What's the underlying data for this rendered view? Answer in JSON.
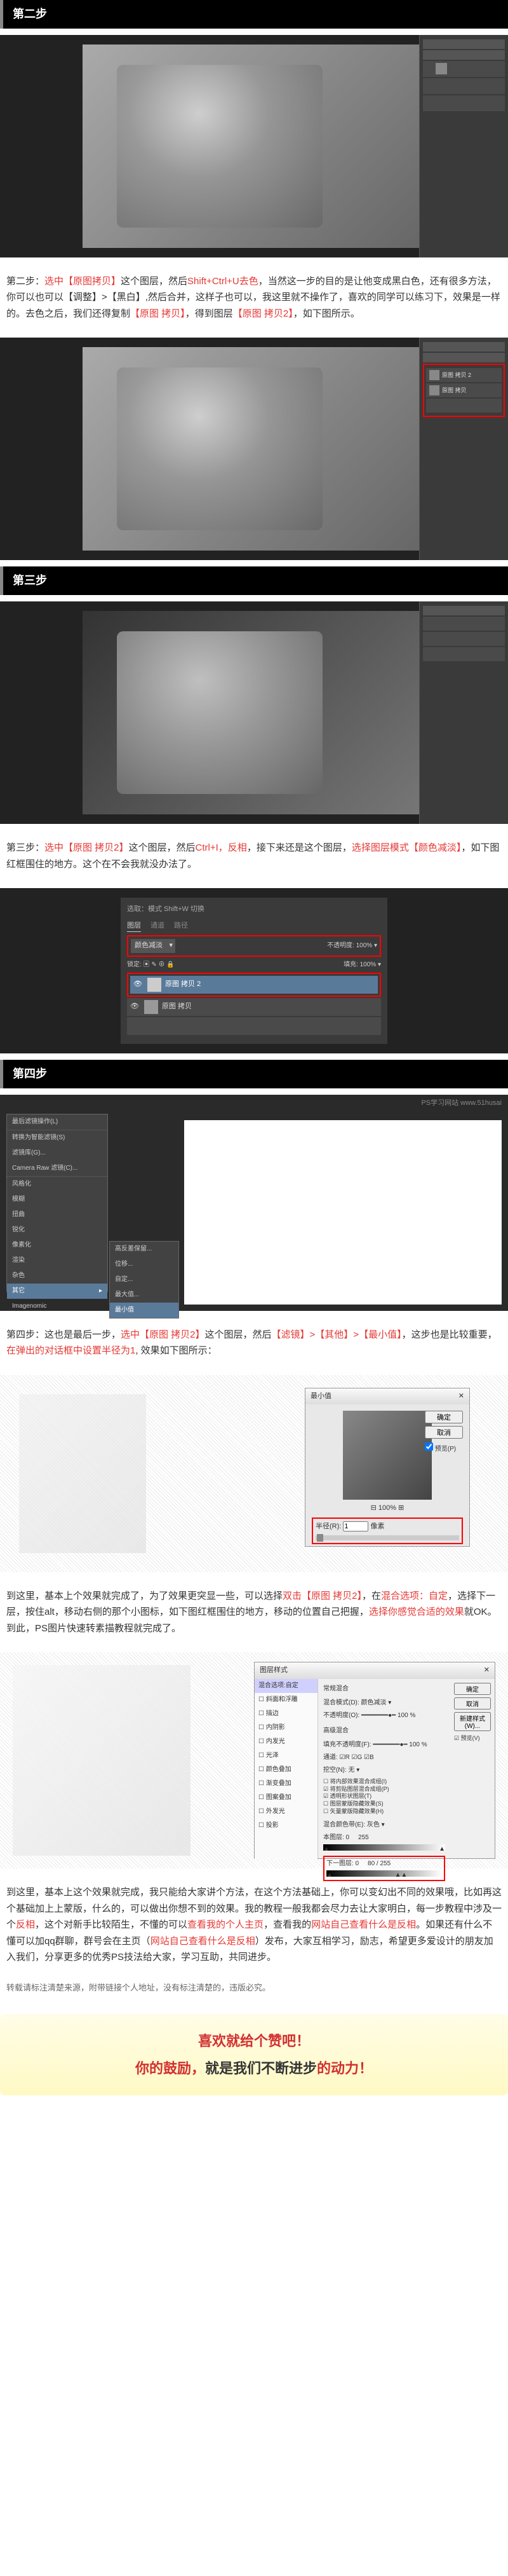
{
  "step2": {
    "header": "第二步",
    "text_parts": [
      "第二步：",
      "选中【原图拷贝】",
      "这个图层，然后",
      "Shift+Ctrl+U去色",
      "，当然这一步的目的是让他变成黑白色，还有很多方法，你可以也可以【调整】>【黑白】,然后合并，这样子也可以，我这里就不操作了，喜欢的同学可以练习下，效果是一样的。去色之后，我们还得复制",
      "【原图 拷贝】",
      "，得到图层",
      "【原图 拷贝2】",
      "，如下图所示。"
    ]
  },
  "step3": {
    "header": "第三步",
    "text_parts": [
      "第三步：",
      "选中【原图 拷贝2】",
      "这个图层，然后",
      "Ctrl+I，反相",
      "，接下来还是这个图层，",
      "选择图层模式【颜色减淡】",
      "，如下图红框围住的地方。这个在不会我就没办法了。"
    ]
  },
  "step4": {
    "header": "第四步",
    "text_parts": [
      "第四步：这也是最后一步，",
      "选中【原图 拷贝2】",
      "这个图层，然后",
      "【滤镜】>【其他】>【最小值】",
      "，这步也是比较重要，",
      "在弹出的对话框中设置半径为1",
      ",  效果如下图所示："
    ],
    "text2_parts": [
      "到这里，基本上个效果就完成了，为了效果更突显一些，可以选择",
      "双击【原图 拷贝2】",
      "，在",
      "混合选项：自定",
      "，选择下一层，按住alt，移动右侧的那个小图标，如下图红框围住的地方，移动的位置自己把握，",
      "选择你感觉合适的效果",
      "就OK。到此，PS图片快速转素描教程就完成了。"
    ],
    "text3_parts": [
      "到这里，基本上这个效果就完成，我只能给大家讲个方法，在这个方法基础上，你可以变幻出不同的效果哦，比如再这个基础加上上蒙版，什么的，可以做出你想不到的效果。我的教程一般我都会尽力去让大家明白，每一步教程中涉及一个",
      "反相",
      "，这个对新手比较陌生，不懂的可以",
      "查看我的个人主页",
      "，查看我的",
      "网站自己查看什么是反相",
      "。如果还有什么不懂可以加qq群聊，群号会在主页（",
      "网站自己查看什么是反相",
      "）发布，大家互相学习，励志，希望更多爱设计的朋友加入我们，分享更多的优秀PS技法给大家，学习互助，共同进步。"
    ],
    "copyright": "转载请标注清楚来源，附带链接个人地址，没有标注清楚的，违版必究。"
  },
  "footer": {
    "line1": "喜欢就给个赞吧！",
    "line2_a": "你的鼓励，",
    "line2_b": "就是我们不断进步",
    "line2_c": "的动力！"
  },
  "ui": {
    "blend_mode": "颜色减淡",
    "opacity": "不透明度",
    "fill": "填充",
    "layer_copy2": "原图 拷贝 2",
    "layer_copy": "原图 拷贝",
    "ps_url": "PS学习网站 www.51husai",
    "min_value": "最小值",
    "radius": "半径",
    "pixel": "像素"
  }
}
